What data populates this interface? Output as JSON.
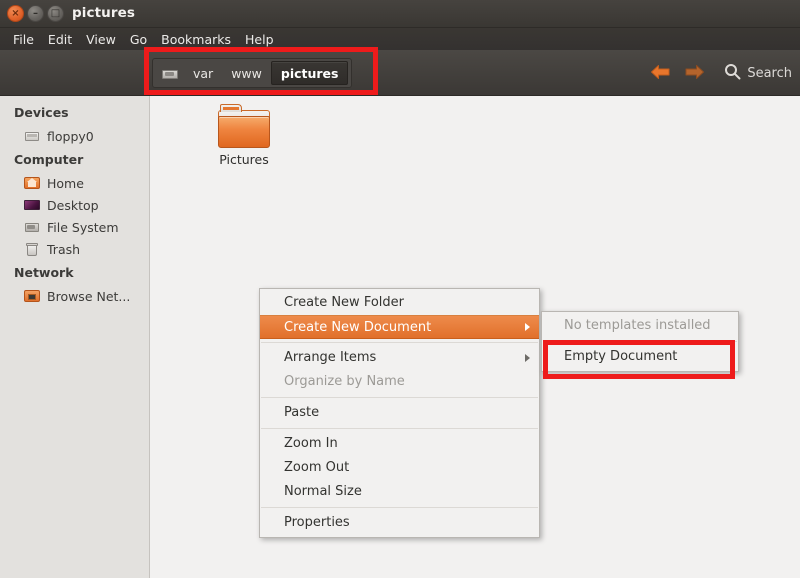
{
  "window": {
    "title": "pictures",
    "buttons": [
      {
        "name": "close",
        "glyph": "×"
      },
      {
        "name": "minimize",
        "glyph": "–"
      },
      {
        "name": "maximize",
        "glyph": "□"
      }
    ]
  },
  "menubar": {
    "items": [
      "File",
      "Edit",
      "View",
      "Go",
      "Bookmarks",
      "Help"
    ]
  },
  "toolbar": {
    "pathbar": {
      "icon": "disk-icon",
      "crumbs": [
        {
          "label": "var",
          "active": false
        },
        {
          "label": "www",
          "active": false
        },
        {
          "label": "pictures",
          "active": true
        }
      ]
    },
    "back_icon": "back-arrow-icon",
    "forward_icon": "forward-arrow-icon",
    "search_icon": "search-icon",
    "search_label": "Search"
  },
  "sidebar": {
    "sections": [
      {
        "heading": "Devices",
        "items": [
          {
            "label": "floppy0",
            "icon": "floppy-icon"
          }
        ]
      },
      {
        "heading": "Computer",
        "items": [
          {
            "label": "Home",
            "icon": "home-folder-icon"
          },
          {
            "label": "Desktop",
            "icon": "desktop-icon"
          },
          {
            "label": "File System",
            "icon": "filesystem-disk-icon"
          },
          {
            "label": "Trash",
            "icon": "trash-icon"
          }
        ]
      },
      {
        "heading": "Network",
        "items": [
          {
            "label": "Browse Net...",
            "icon": "network-folder-icon"
          }
        ]
      }
    ]
  },
  "content": {
    "files": [
      {
        "name": "Pictures",
        "icon": "folder-icon"
      }
    ]
  },
  "context_menu": {
    "items": [
      {
        "label": "Create New Folder",
        "selected": false,
        "disabled": false,
        "submenu": false
      },
      {
        "label": "Create New Document",
        "selected": true,
        "disabled": false,
        "submenu": true
      },
      {
        "label": "Arrange Items",
        "selected": false,
        "disabled": false,
        "submenu": true
      },
      {
        "label": "Organize by Name",
        "selected": false,
        "disabled": true,
        "submenu": false
      },
      {
        "label": "Paste",
        "selected": false,
        "disabled": false,
        "submenu": false
      },
      {
        "label": "Zoom In",
        "selected": false,
        "disabled": false,
        "submenu": false
      },
      {
        "label": "Zoom Out",
        "selected": false,
        "disabled": false,
        "submenu": false
      },
      {
        "label": "Normal Size",
        "selected": false,
        "disabled": false,
        "submenu": false
      },
      {
        "label": "Properties",
        "selected": false,
        "disabled": false,
        "submenu": false
      }
    ]
  },
  "submenu": {
    "items": [
      {
        "label": "No templates installed",
        "disabled": true
      },
      {
        "label": "Empty Document",
        "disabled": false
      }
    ]
  },
  "annotations": {
    "highlight_color": "#ee1b1b",
    "boxes": [
      "pathbar-highlight",
      "empty-document-highlight"
    ]
  },
  "colors": {
    "titlebar": "#3a3733",
    "accent_orange": "#e1702b",
    "sidebar_bg": "#e3e1de",
    "content_bg": "#f2f1f0"
  }
}
